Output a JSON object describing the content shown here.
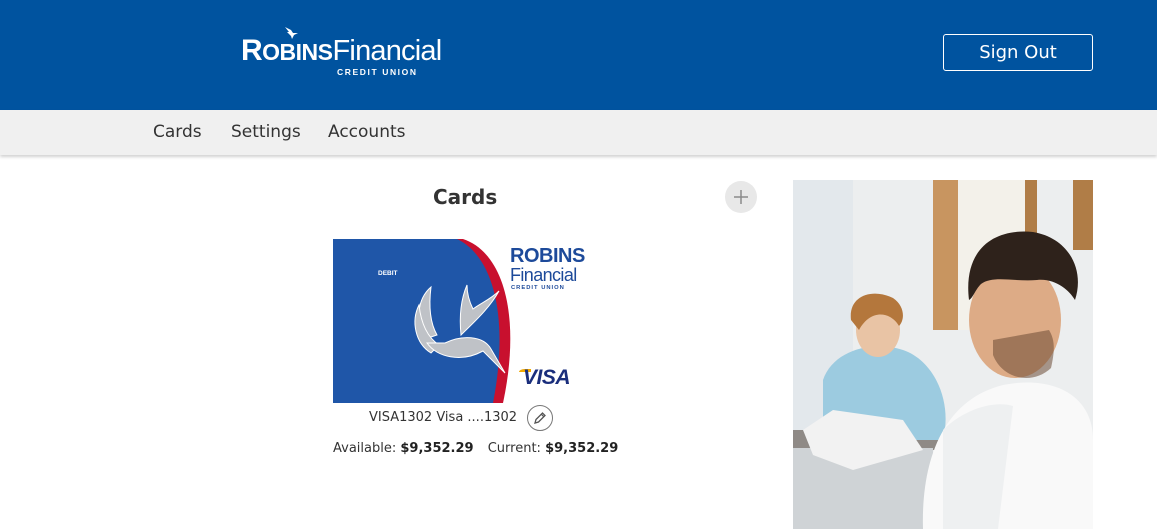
{
  "header": {
    "logo": {
      "robins_big": "R",
      "robins_rest": "OBINS",
      "financial": "Financial",
      "credit_union": "CREDIT UNION"
    },
    "signout_label": "Sign Out",
    "background_color": "#00539f"
  },
  "nav": {
    "items": [
      {
        "label": "Cards"
      },
      {
        "label": "Settings"
      },
      {
        "label": "Accounts"
      }
    ]
  },
  "main": {
    "title": "Cards",
    "add_icon": "plus-icon",
    "card": {
      "type_label": "DEBIT",
      "brand_robins": "ROBINS",
      "brand_financial": "Financial",
      "brand_cu": "CREDIT UNION",
      "network": "VISA",
      "name": "VISA1302 Visa ....1302",
      "edit_icon": "pencil-icon",
      "available_label": "Available:",
      "available_value": "$9,352.29",
      "current_label": "Current:",
      "current_value": "$9,352.29"
    }
  },
  "colors": {
    "brand_blue": "#00539f",
    "card_blue": "#1f56a8",
    "card_red": "#c8102e",
    "nav_bg": "#f0f0f0"
  }
}
